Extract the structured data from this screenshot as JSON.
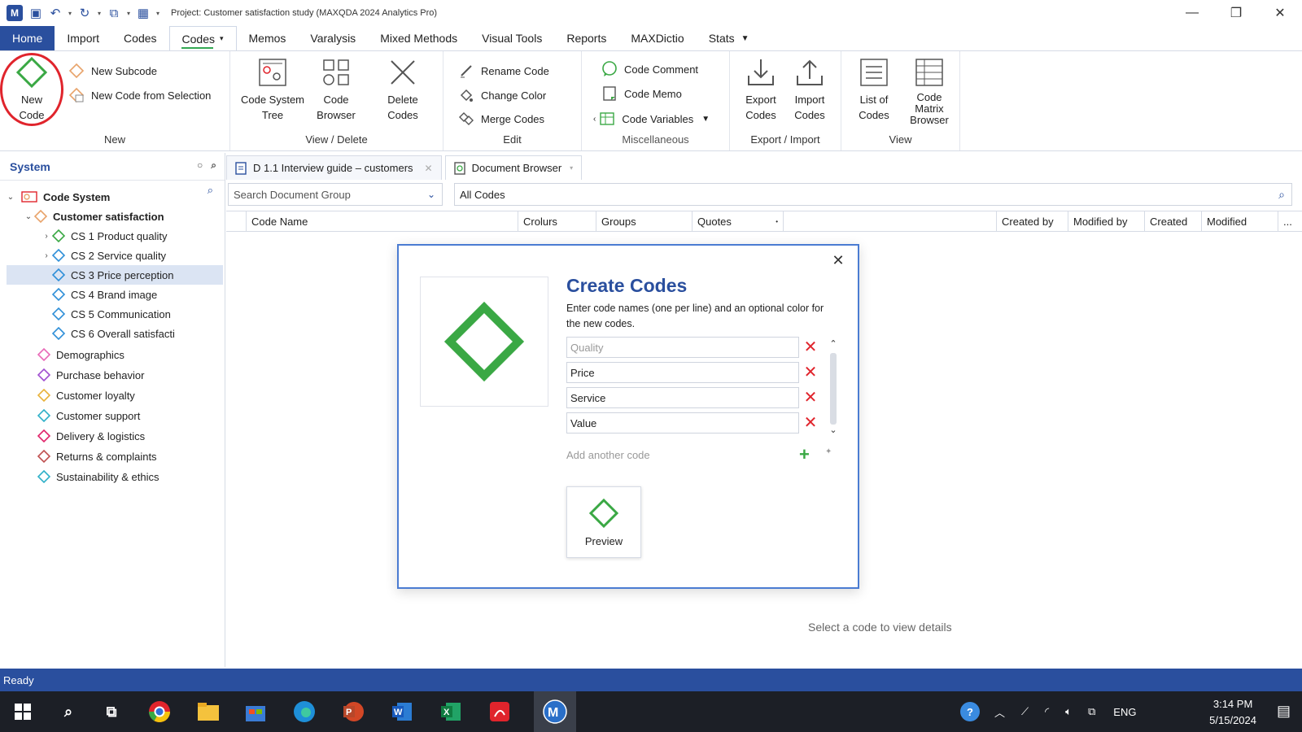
{
  "window": {
    "title": "Project: Customer satisfaction study (MAXQDA 2024 Analytics Pro)",
    "logo_text": "M",
    "minimize": "—",
    "restore": "❐",
    "close": "✕"
  },
  "tabs": [
    "Home",
    "Import",
    "Codes",
    "Codes",
    "Memos",
    "Varalysis",
    "Mixed Methods",
    "Visual Tools",
    "Reports",
    "MAXDictio",
    "Stats"
  ],
  "ribbon": {
    "new_group": {
      "label": "New",
      "new_code": "New Code",
      "new_subcode": "New Subcode",
      "new_from_selection": "New Code from Selection"
    },
    "view_delete_group": {
      "label": "View / Delete",
      "code_system_tree": "Code System Tree",
      "code_browser": "Code Browser",
      "delete_codes": "Delete Codes"
    },
    "edit_group": {
      "label": "Edit",
      "rename_code": "Rename Code",
      "change_color": "Change Color",
      "merge_codes": "Merge Codes"
    },
    "misc_group": {
      "label": "Miscellaneous",
      "code_comment": "Code Comment",
      "code_memo": "Code Memo",
      "code_variables": "Code Variables"
    },
    "export_group": {
      "label": "Export / Import",
      "export_codes": "Export Codes",
      "import_codes": "Import Codes"
    },
    "view_group": {
      "label": "View",
      "list_of_codes": "List of Codes",
      "code_matrix_browser": "Code Matrix Browser"
    }
  },
  "left_panel": {
    "title": "System",
    "root": "Code System",
    "items": [
      {
        "label": "Customer satisfaction",
        "level": 1,
        "bold": true,
        "color": "#e8a36a"
      },
      {
        "label": "CS 1 Product quality",
        "level": 2,
        "color": "#3aa844"
      },
      {
        "label": "CS 2 Service quality",
        "level": 2,
        "color": "#2f8fd8"
      },
      {
        "label": "CS 3 Price perception",
        "level": 2,
        "color": "#2f8fd8",
        "selected": true
      },
      {
        "label": "CS 4 Brand image",
        "level": 2,
        "color": "#2f8fd8"
      },
      {
        "label": "CS 5 Communication",
        "level": 2,
        "color": "#2f8fd8"
      },
      {
        "label": "CS 6 Overall satisfacti",
        "level": 2,
        "color": "#2f8fd8"
      },
      {
        "label": "Demographics",
        "level": 1,
        "color": "#e86ab8"
      },
      {
        "label": "Purchase behavior",
        "level": 1,
        "color": "#a04fd0"
      },
      {
        "label": "Customer loyalty",
        "level": 1,
        "color": "#e8b23a"
      },
      {
        "label": "Customer support",
        "level": 1,
        "color": "#2fb0c8"
      },
      {
        "label": "Delivery & logistics",
        "level": 1,
        "color": "#e0246a"
      },
      {
        "label": "Returns & complaints",
        "level": 1,
        "color": "#c05050"
      },
      {
        "label": "Sustainability & ethics",
        "level": 1,
        "color": "#2fb0c8"
      }
    ]
  },
  "doc_tabs": [
    {
      "label": "D 1.1 Interview guide – customers"
    },
    {
      "label": "Document Browser"
    }
  ],
  "filters": {
    "doc_group_placeholder": "Search Document Group",
    "codes_value": "All Codes"
  },
  "columns": [
    "Code Name",
    "Crolurs",
    "Groups",
    "Quotes",
    "Created by",
    "Modified by",
    "Created",
    "Modified",
    "..."
  ],
  "dialog": {
    "title": "Create Codes",
    "description": "Enter code names (one per line) and an optional color for the new codes.",
    "inputs": [
      {
        "value": "",
        "placeholder": "Quality"
      },
      {
        "value": "Price",
        "placeholder": ""
      },
      {
        "value": "Service",
        "placeholder": ""
      },
      {
        "value": "Value",
        "placeholder": ""
      }
    ],
    "add_another": "Add another code",
    "preview": "Preview",
    "accent_color": "#3aa844"
  },
  "select_message": "Select a code to view details",
  "status": "Ready",
  "taskbar": {
    "lang": "ENG",
    "time": "3:14 PM",
    "date": "5/15/2024"
  }
}
